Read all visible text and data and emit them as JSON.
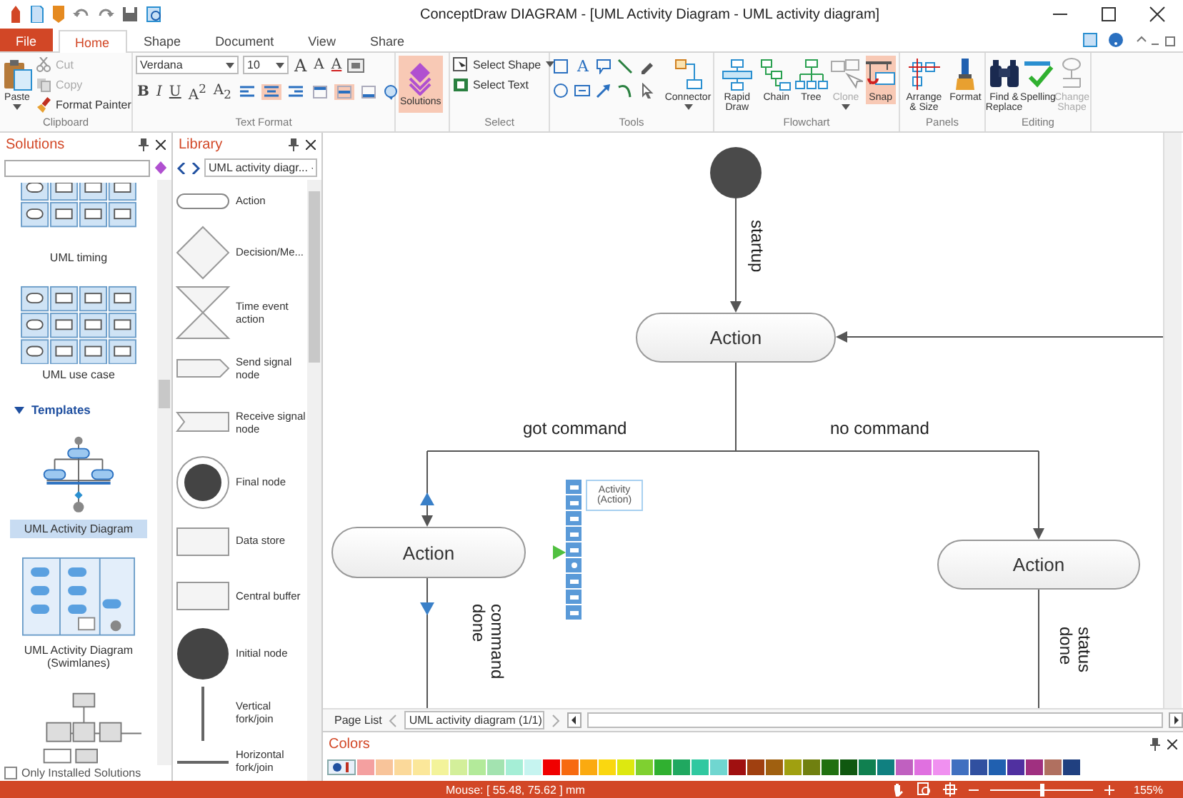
{
  "window": {
    "title": "ConceptDraw DIAGRAM - [UML Activity Diagram - UML activity diagram]"
  },
  "tabs": [
    {
      "label": "File",
      "kind": "file",
      "selected": false
    },
    {
      "label": "Home",
      "kind": "tab",
      "selected": true
    },
    {
      "label": "Shape",
      "kind": "tab",
      "selected": false
    },
    {
      "label": "Document",
      "kind": "tab",
      "selected": false
    },
    {
      "label": "View",
      "kind": "tab",
      "selected": false
    },
    {
      "label": "Share",
      "kind": "tab",
      "selected": false
    }
  ],
  "ribbon": {
    "clipboard": {
      "label": "Clipboard",
      "paste": "Paste",
      "items": [
        {
          "label": "Cut",
          "disabled": true
        },
        {
          "label": "Copy",
          "disabled": true
        },
        {
          "label": "Format Painter",
          "disabled": false
        }
      ]
    },
    "text_format": {
      "label": "Text Format",
      "font": "Verdana",
      "size": "10",
      "font_buttons": [
        "A",
        "A",
        "A"
      ],
      "style_buttons": [
        {
          "glyph": "B",
          "selected": false
        },
        {
          "glyph": "I",
          "selected": false
        },
        {
          "glyph": "U",
          "selected": false
        },
        {
          "glyph": "A$^{2}$",
          "selected": false
        },
        {
          "glyph": "A$_{2}$",
          "selected": false
        }
      ],
      "align_buttons": [
        {
          "selected": false
        },
        {
          "selected": true
        },
        {
          "selected": false
        }
      ],
      "valign_buttons": [
        {
          "selected": false
        },
        {
          "selected": true
        },
        {
          "selected": false
        }
      ]
    },
    "solutions": {
      "label": "Solutions",
      "selected": true
    },
    "select": {
      "label": "Select",
      "items": [
        "Select Shape",
        "Select Text"
      ]
    },
    "tools": {
      "label": "Tools",
      "text_tool": "A",
      "connector": "Connector"
    },
    "groups": [
      {
        "label": "Flowchart",
        "buttons": [
          {
            "label": "Rapid Draw",
            "disabled": false,
            "selected": false
          },
          {
            "label": "Chain",
            "disabled": false,
            "selected": false
          },
          {
            "label": "Tree",
            "disabled": false,
            "selected": false
          },
          {
            "label": "Clone",
            "disabled": true,
            "selected": false
          },
          {
            "label": "Snap",
            "disabled": false,
            "selected": true
          }
        ]
      },
      {
        "label": "Panels",
        "buttons": [
          {
            "label": "Arrange & Size",
            "disabled": false,
            "selected": false
          },
          {
            "label": "Format",
            "disabled": false,
            "selected": false
          }
        ]
      },
      {
        "label": "Editing",
        "buttons": [
          {
            "label": "Find & Replace",
            "disabled": false,
            "selected": false
          },
          {
            "label": "Spelling",
            "disabled": false,
            "selected": false
          },
          {
            "label": "Change Shape",
            "disabled": true,
            "selected": false
          }
        ]
      }
    ]
  },
  "solutions_panel": {
    "title": "Solutions",
    "sections": [
      {
        "label": "UML timing"
      },
      {
        "label": "UML use case"
      }
    ],
    "templates_header": {
      "label": "Templates",
      "expanded": true
    },
    "templates": [
      {
        "label": "UML Activity Diagram",
        "selected": true
      },
      {
        "label": "UML Activity Diagram (Swimlanes)",
        "selected": false
      }
    ],
    "only_installed": {
      "label": "Only Installed Solutions",
      "checked": false
    }
  },
  "library_panel": {
    "title": "Library",
    "dropdown": "UML activity diagr...",
    "items": [
      {
        "label": "Action"
      },
      {
        "label": "Decision/Me..."
      },
      {
        "label": "Time event action"
      },
      {
        "label": "Send signal node"
      },
      {
        "label": "Receive signal node"
      },
      {
        "label": "Final node"
      },
      {
        "label": "Data store"
      },
      {
        "label": "Central buffer"
      },
      {
        "label": "Initial node"
      },
      {
        "label": "Vertical fork/join"
      },
      {
        "label": "Horizontal fork/join"
      }
    ]
  },
  "diagram": {
    "actions": [
      {
        "label": "Action"
      },
      {
        "label": "Action"
      },
      {
        "label": "Action"
      }
    ],
    "edge_labels": [
      {
        "text": "startup"
      },
      {
        "text": "got command"
      },
      {
        "text": "no command"
      },
      {
        "text": "command done"
      },
      {
        "text": "status done"
      }
    ],
    "tooltip": "Activity (Action)"
  },
  "page_list": {
    "label": "Page List",
    "page": "UML activity diagram (1/1)"
  },
  "colors_panel": {
    "title": "Colors",
    "swatches": [
      {
        "color": "#f4a0a0"
      },
      {
        "color": "#f8c49a"
      },
      {
        "color": "#fbd99a"
      },
      {
        "color": "#fbe79a"
      },
      {
        "color": "#f3f39a"
      },
      {
        "color": "#d3ef9a"
      },
      {
        "color": "#b3ea9a"
      },
      {
        "color": "#a3e3b0"
      },
      {
        "color": "#a5eed6"
      },
      {
        "color": "#c6f4f0"
      },
      {
        "color": "#f00000"
      },
      {
        "color": "#f76a10"
      },
      {
        "color": "#fbaa10"
      },
      {
        "color": "#fad710"
      },
      {
        "color": "#dde810"
      },
      {
        "color": "#7fd030"
      },
      {
        "color": "#30b030"
      },
      {
        "color": "#20a860"
      },
      {
        "color": "#30c8a0"
      },
      {
        "color": "#70d6d0"
      },
      {
        "color": "#a01010"
      },
      {
        "color": "#a04010"
      },
      {
        "color": "#a06010"
      },
      {
        "color": "#a0a010"
      },
      {
        "color": "#708010"
      },
      {
        "color": "#207010"
      },
      {
        "color": "#105810"
      },
      {
        "color": "#108050"
      },
      {
        "color": "#108080"
      },
      {
        "color": "#c060c0"
      },
      {
        "color": "#e070e0"
      },
      {
        "color": "#f090f0"
      },
      {
        "color": "#4070c0"
      },
      {
        "color": "#3050a0"
      },
      {
        "color": "#2060b0"
      },
      {
        "color": "#5030a0"
      },
      {
        "color": "#a03080"
      },
      {
        "color": "#b07060"
      },
      {
        "color": "#204080"
      }
    ]
  },
  "status_bar": {
    "mouse": "Mouse: [ 55.48, 75.62 ] mm",
    "zoom": {
      "level": 0.52,
      "reading": "155%"
    }
  }
}
